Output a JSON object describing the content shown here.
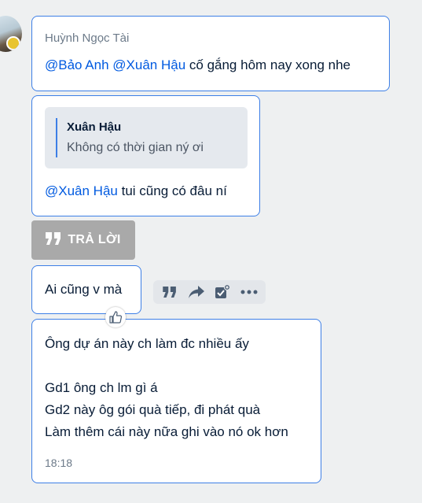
{
  "message1": {
    "sender": "Huỳnh Ngọc Tài",
    "mention1": "@Bảo Anh",
    "mention2": "@Xuân Hậu",
    "text": "cố gắng hôm nay xong nhe"
  },
  "message2": {
    "quote_name": "Xuân Hậu",
    "quote_text": "Không có thời gian ný ơi",
    "mention": "@Xuân Hậu",
    "text": "tui cũng có đâu ní"
  },
  "reply_button": {
    "label": "TRẢ LỜI"
  },
  "message3": {
    "text": "Ai cũng v mà"
  },
  "message4": {
    "lines": [
      "Ông dự án này ch làm đc nhiều ấy",
      "",
      "Gd1 ông ch lm gì á",
      "Gd2 này ôg gói quà tiếp, đi phát quà",
      "Làm thêm cái này nữa ghi vào nó ok hơn"
    ],
    "time": "18:18"
  },
  "icons": {
    "quote": "quote-icon",
    "forward": "forward-icon",
    "todo": "todo-icon",
    "more": "more-icon",
    "like": "like-icon"
  },
  "colors": {
    "accent": "#3d7fe6",
    "mention": "#005ae0",
    "background": "#eef0f1"
  }
}
